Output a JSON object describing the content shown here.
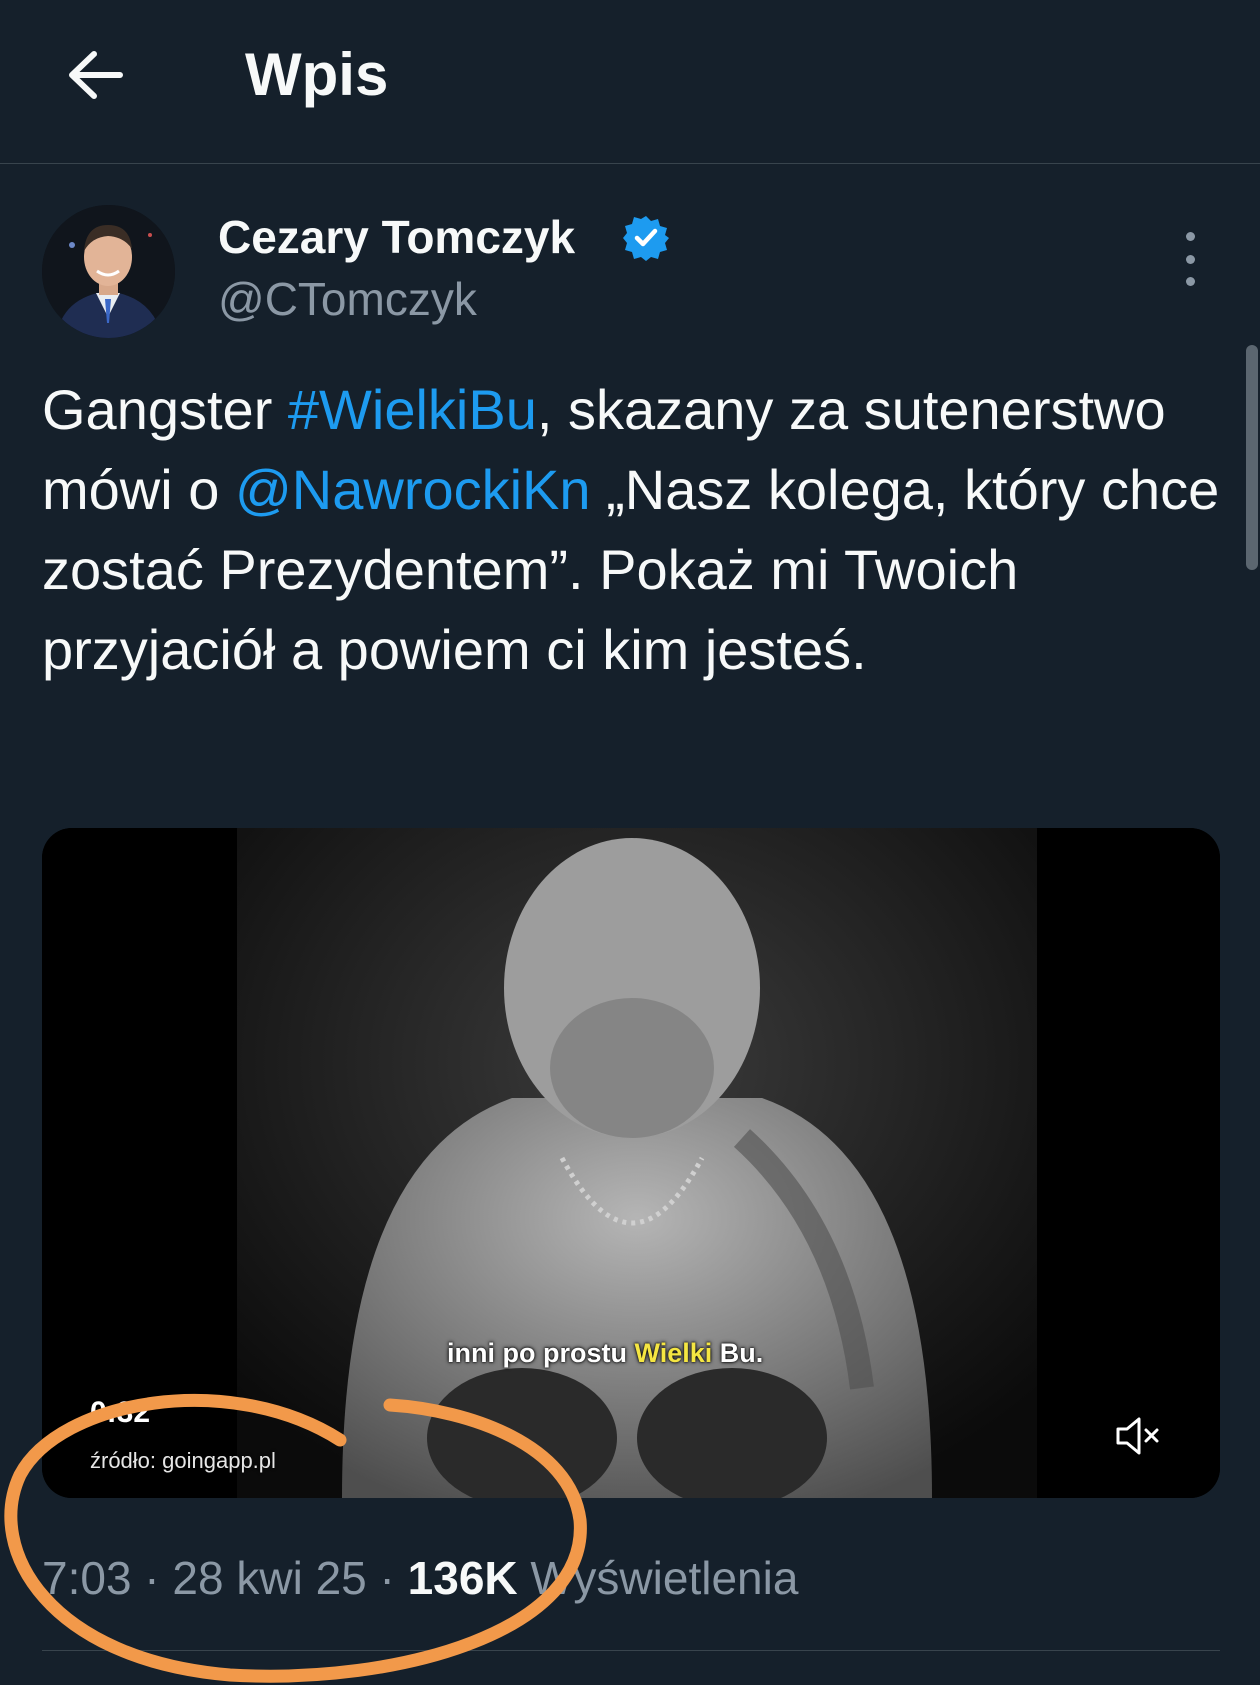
{
  "header": {
    "title": "Wpis",
    "back_icon": "arrow-left-icon"
  },
  "author": {
    "name": "Cezary Tomczyk",
    "handle": "@CTomczyk",
    "verified": true,
    "verified_color": "#1d9bf0"
  },
  "tweet": {
    "text_parts": {
      "p1": "Gangster ",
      "hashtag": "#WielkiBu",
      "p2": ", skazany za sutenerstwo mówi o ",
      "mention": "@NawrockiKn",
      "p3": " „Nasz kolega, który chce zostać Prezydentem”. Pokaż mi Twoich przyjaciół a powiem ci kim jesteś."
    },
    "link_color": "#1d9bf0"
  },
  "media": {
    "subtitle_pre": "inni po prostu ",
    "subtitle_highlight": "Wielki",
    "subtitle_post": " Bu.",
    "timer": "0:32",
    "source": "źródło: goingapp.pl",
    "mute_icon": "volume-muted-icon"
  },
  "meta": {
    "time": "7:03",
    "sep1": " · ",
    "date": "28 kwi 25",
    "sep2": " · ",
    "views_count": "136K",
    "views_label": " Wyświetlenia"
  },
  "colors": {
    "background": "#15202b",
    "divider": "#38444d",
    "secondary_text": "#8b98a5",
    "annotation": "#f2994a"
  }
}
